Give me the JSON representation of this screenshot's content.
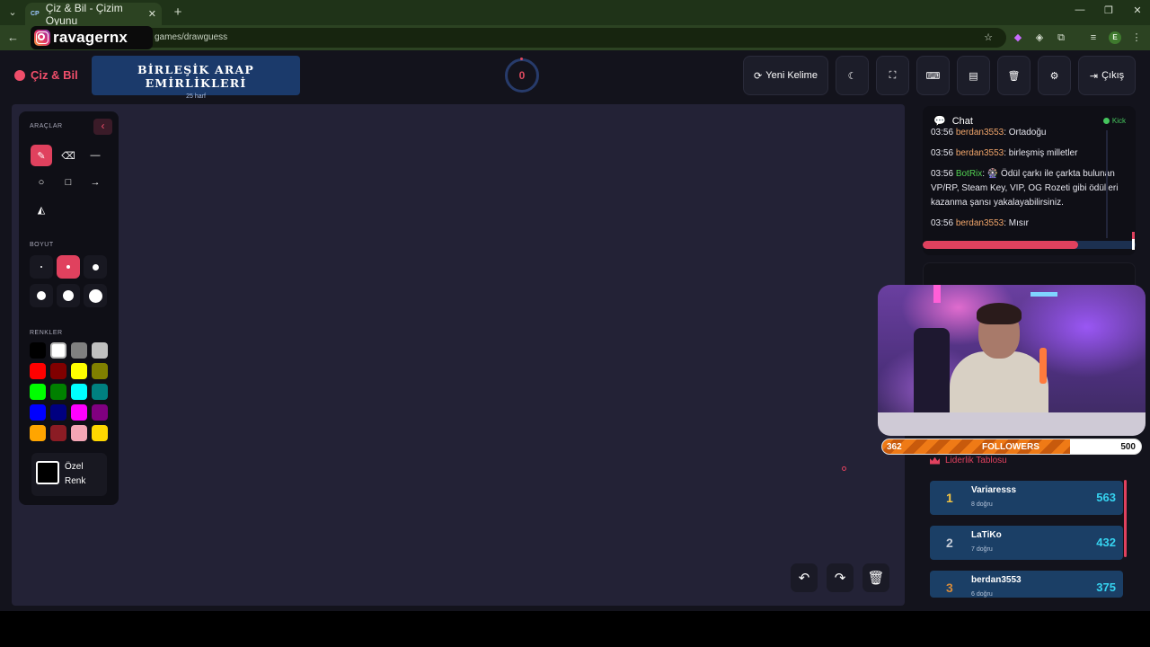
{
  "browser": {
    "tab_title": "Çiz & Bil - Çizim Oyunu",
    "tab_favicon": "CP",
    "url_visible": "games/drawguess",
    "overlay_handle": "ravagernx",
    "profile_initial": "E"
  },
  "header": {
    "brand": "Çiz & Bil",
    "word": "BİRLEŞİK ARAP EMİRLİKLERİ",
    "letter_count": "25 harf",
    "timer": "0",
    "new_word_label": "Yeni Kelime",
    "exit_label": "Çıkış"
  },
  "tools": {
    "section_tools": "ARAÇLAR",
    "section_size": "BOYUT",
    "section_colors": "RENKLER",
    "custom_color_label": "Özel Renk",
    "active_tool": "pen-icon",
    "active_size_index": 1,
    "selected_color_index": 21,
    "colors": [
      "#000000",
      "#ffffff",
      "#808080",
      "#c0c0c0",
      "#ff0000",
      "#800000",
      "#ffff00",
      "#808000",
      "#00ff00",
      "#008000",
      "#00ffff",
      "#008080",
      "#0000ff",
      "#000080",
      "#ff00ff",
      "#800080",
      "#ffa500",
      "#8b1c24",
      "#f4a6b5",
      "#ffd700"
    ]
  },
  "chat": {
    "title": "Chat",
    "platform": "Kick",
    "messages": [
      {
        "time": "03:56",
        "user": "berdan3553",
        "text": "Ortadoğu",
        "color": "#f0a56a"
      },
      {
        "time": "03:56",
        "user": "berdan3553",
        "text": "birleşmiş milletler",
        "color": "#f0a56a"
      },
      {
        "time": "03:56",
        "user": "BotRix",
        "text": "🎡 Ödül çarkı ile çarkta bulunan VP/RP, Steam Key, VIP, OG Rozeti gibi ödülleri kazanma şansı yakalayabilirsiniz.",
        "color": "#52d052"
      },
      {
        "time": "03:56",
        "user": "berdan3553",
        "text": "Mısır",
        "color": "#f0a56a"
      }
    ],
    "progress_fraction": 0.73
  },
  "followers": {
    "current": "362",
    "label": "FOLLOWERS",
    "goal": "500",
    "fill_fraction": 0.724
  },
  "leaderboard": {
    "title": "Liderlik Tablosu",
    "entries": [
      {
        "rank": "1",
        "name": "Variaresss",
        "sub": "8 doğru",
        "score": "563",
        "rank_color": "#f5c542"
      },
      {
        "rank": "2",
        "name": "LaTiKo",
        "sub": "7 doğru",
        "score": "432",
        "rank_color": "#c5ccd8"
      },
      {
        "rank": "3",
        "name": "berdan3553",
        "sub": "6 doğru",
        "score": "375",
        "rank_color": "#d58a3a"
      }
    ]
  },
  "colors": {
    "accent": "#e0415e",
    "canvas": "#232236",
    "panel": "#0f0f16",
    "word_box": "#1b3a6b",
    "score": "#36d3f0"
  }
}
